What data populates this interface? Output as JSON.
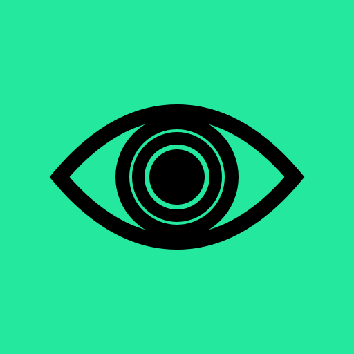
{
  "icon": {
    "name": "eye-icon",
    "background_color": "#24E89D",
    "foreground_color": "#000000"
  }
}
